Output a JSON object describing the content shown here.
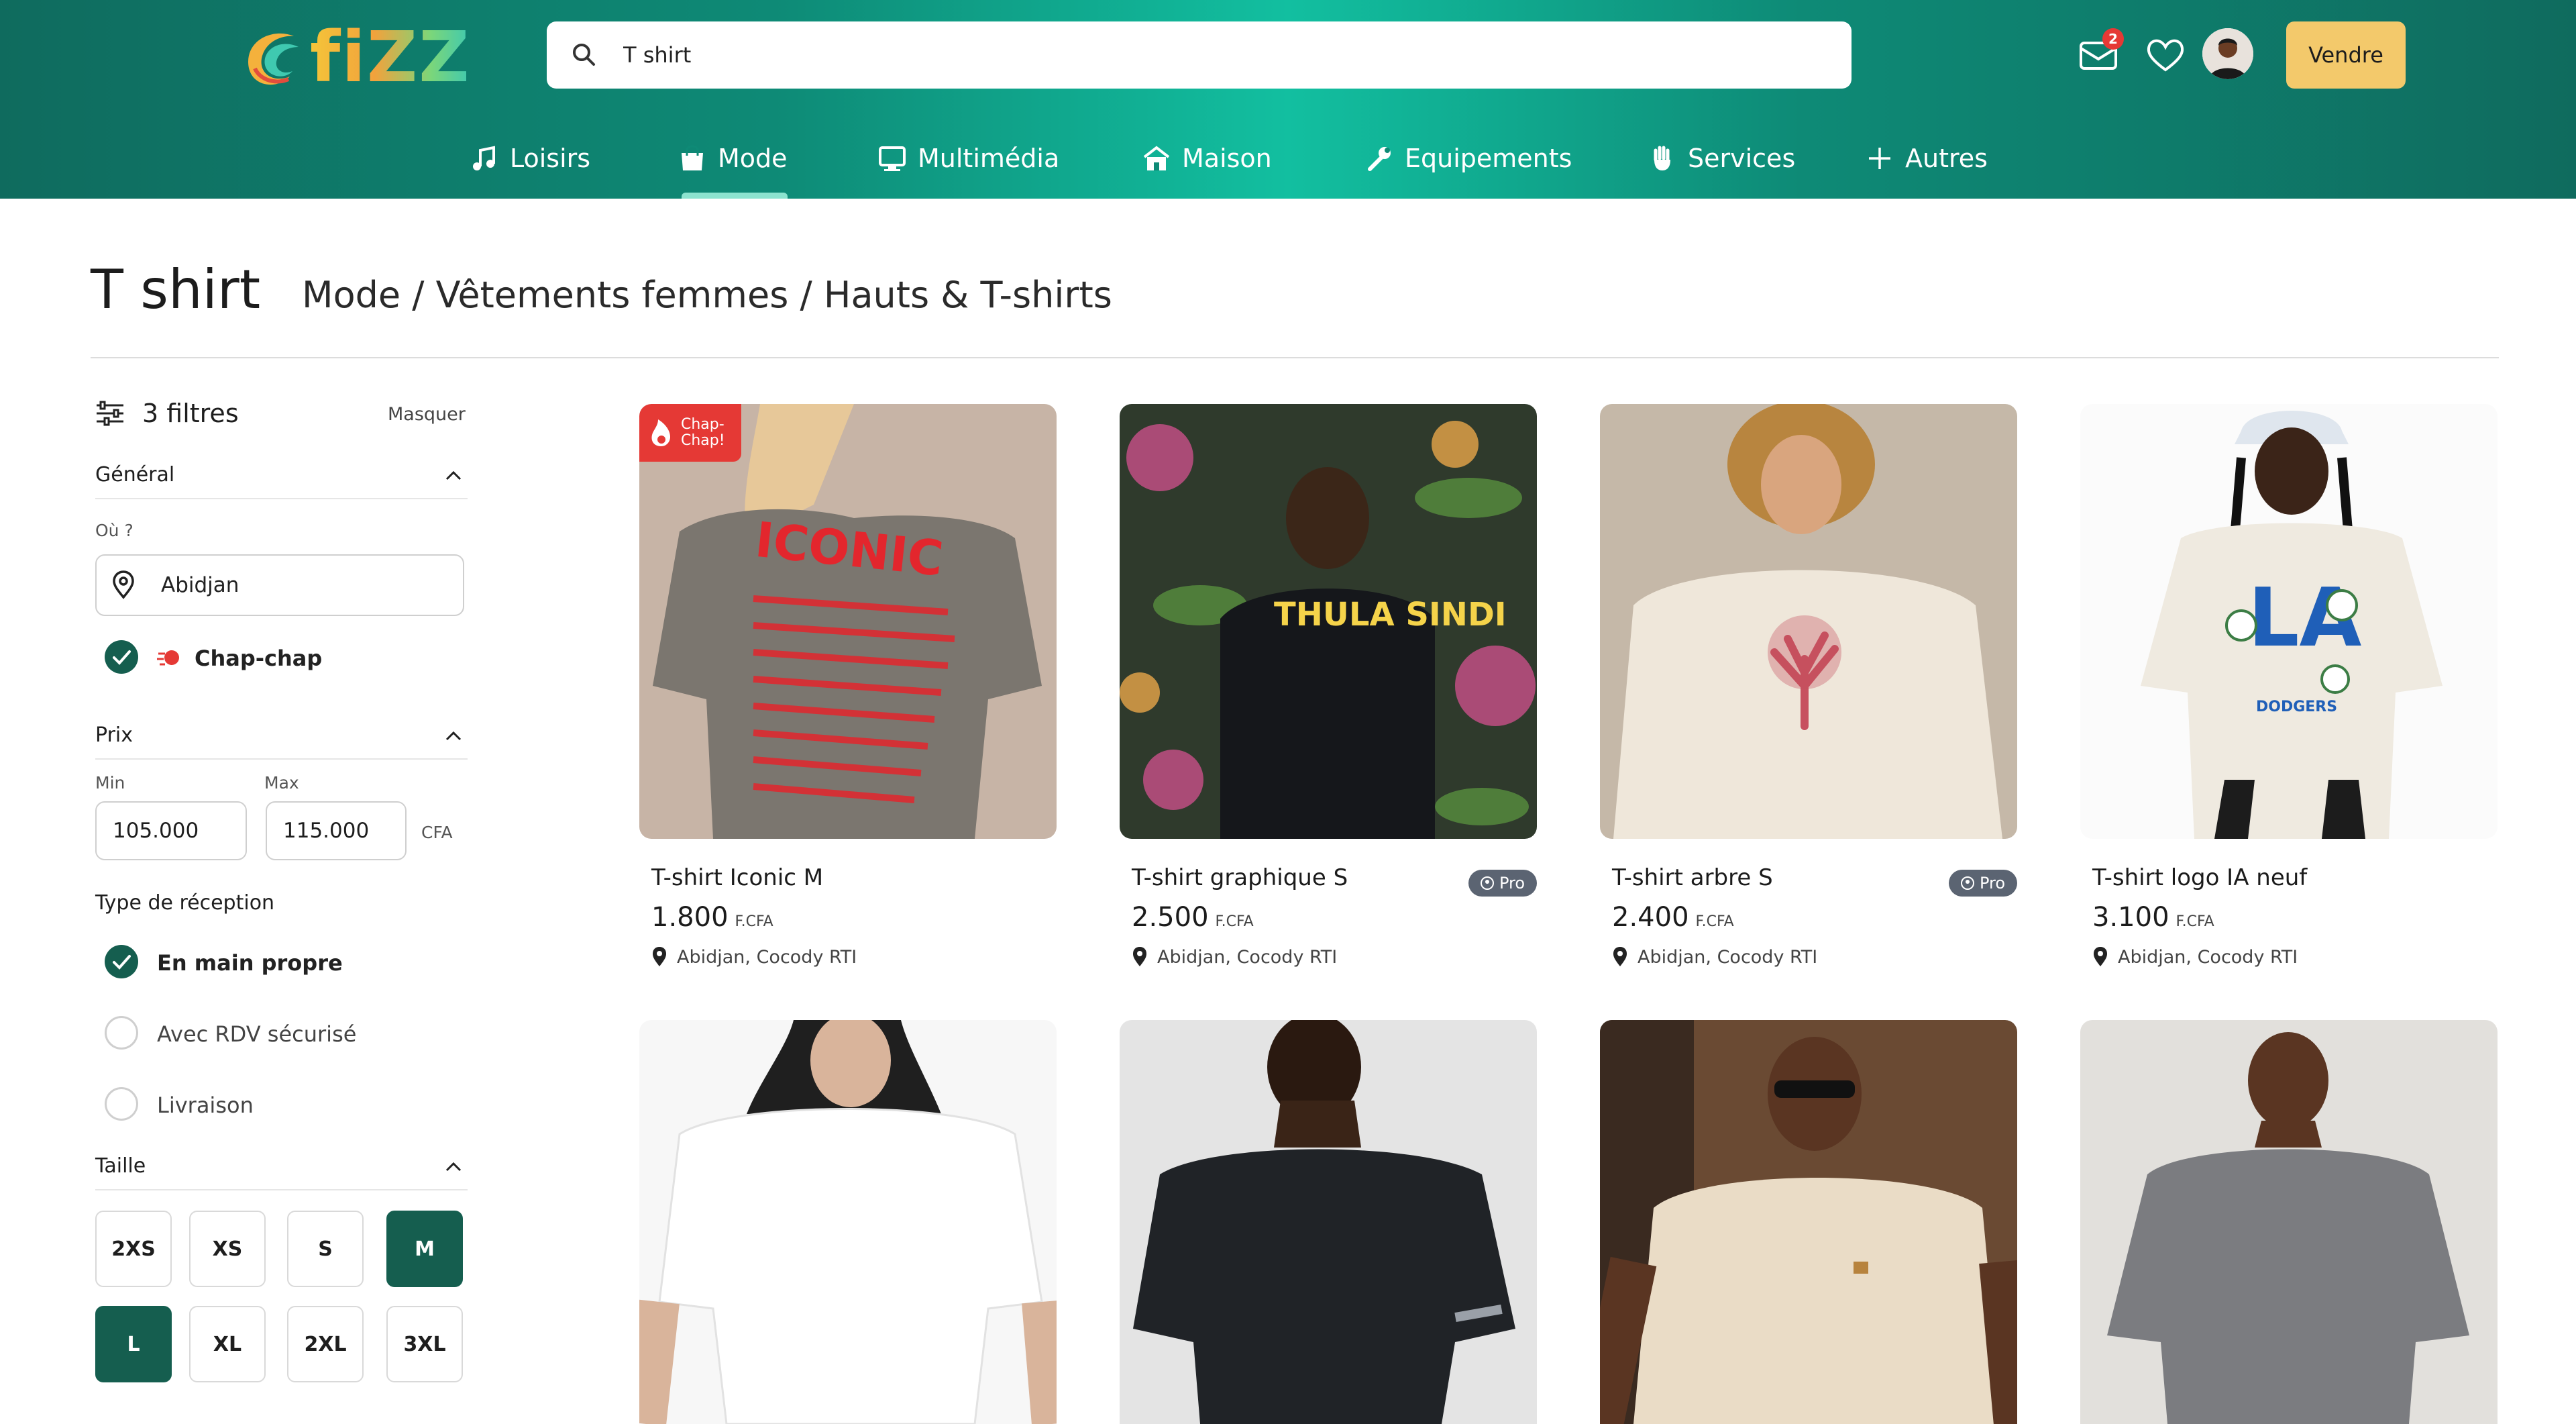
{
  "brand": {
    "name": "fiZZ"
  },
  "search": {
    "value": "T shirt"
  },
  "header": {
    "notif_count": "2",
    "sell_label": "Vendre"
  },
  "nav": [
    {
      "label": "Loisirs",
      "icon": "music-note-icon"
    },
    {
      "label": "Mode",
      "icon": "shopping-bag-icon"
    },
    {
      "label": "Multimédia",
      "icon": "monitor-icon"
    },
    {
      "label": "Maison",
      "icon": "house-icon"
    },
    {
      "label": "Equipements",
      "icon": "wrench-icon"
    },
    {
      "label": "Services",
      "icon": "hand-icon"
    },
    {
      "label": "Autres",
      "icon": "plus-icon"
    }
  ],
  "page": {
    "title": "T shirt",
    "breadcrumb": "Mode / Vêtements femmes / Hauts & T-shirts"
  },
  "filters": {
    "count_label": "3 filtres",
    "hide_label": "Masquer",
    "general": {
      "title": "Général",
      "where_label": "Où ?",
      "where_value": "Abidjan",
      "chap_label": "Chap-chap"
    },
    "price": {
      "title": "Prix",
      "min_label": "Min",
      "max_label": "Max",
      "min_value": "105.000",
      "max_value": "115.000",
      "currency": "CFA"
    },
    "reception": {
      "title": "Type de réception",
      "options": [
        "En main propre",
        "Avec RDV sécurisé",
        "Livraison"
      ]
    },
    "size": {
      "title": "Taille",
      "options": [
        "2XS",
        "XS",
        "S",
        "M",
        "L",
        "XL",
        "2XL",
        "3XL"
      ]
    }
  },
  "products": [
    {
      "name": "T-shirt Iconic M",
      "price": "1.800",
      "currency": "F.CFA",
      "location": "Abidjan, Cocody RTI",
      "chap_label": "Chap-\nChap!",
      "img_text": "ICONIC"
    },
    {
      "name": "T-shirt graphique S",
      "price": "2.500",
      "currency": "F.CFA",
      "location": "Abidjan, Cocody RTI",
      "pro_label": "Pro",
      "img_text": "THULA SINDI"
    },
    {
      "name": "T-shirt arbre S",
      "price": "2.400",
      "currency": "F.CFA",
      "location": "Abidjan, Cocody RTI",
      "pro_label": "Pro"
    },
    {
      "name": "T-shirt logo IA neuf",
      "price": "3.100",
      "currency": "F.CFA",
      "location": "Abidjan, Cocody RTI",
      "img_text": "DODGERS"
    }
  ],
  "colors": {
    "header": "#0e8a76",
    "accent": "#155e4f",
    "sell": "#f3c96b",
    "badge": "#e53935"
  }
}
